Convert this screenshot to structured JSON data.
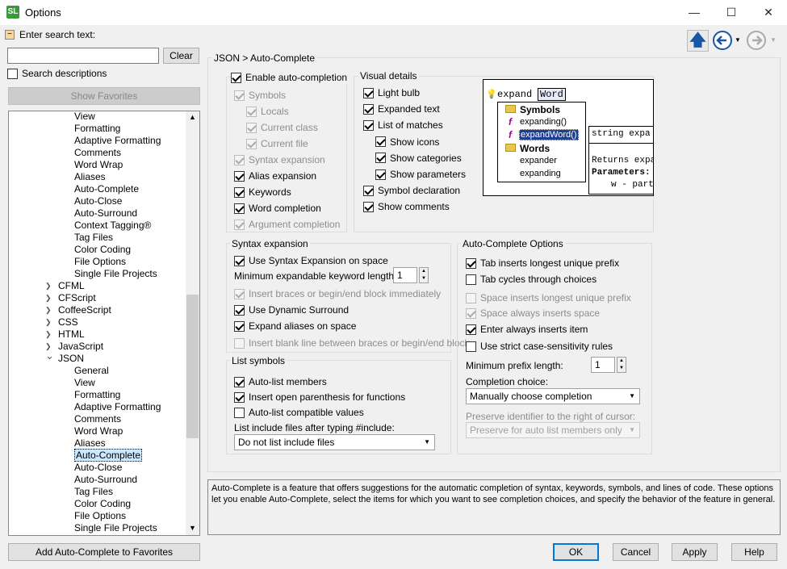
{
  "window": {
    "title": "Options",
    "app_icon_text": "SL",
    "minimize": "—",
    "maximize": "☐",
    "close": "✕"
  },
  "search": {
    "label": "Enter search text:",
    "value": "",
    "clear": "Clear",
    "desc_label": "Search descriptions",
    "show_favorites": "Show Favorites"
  },
  "nav": {
    "icons": [
      "up-arrow-icon",
      "back-arrow-icon",
      "forward-arrow-icon"
    ]
  },
  "tree": [
    {
      "label": "View",
      "level": 2
    },
    {
      "label": "Formatting",
      "level": 2
    },
    {
      "label": "Adaptive Formatting",
      "level": 2
    },
    {
      "label": "Comments",
      "level": 2
    },
    {
      "label": "Word Wrap",
      "level": 2
    },
    {
      "label": "Aliases",
      "level": 2
    },
    {
      "label": "Auto-Complete",
      "level": 2
    },
    {
      "label": "Auto-Close",
      "level": 2
    },
    {
      "label": "Auto-Surround",
      "level": 2
    },
    {
      "label": "Context Tagging®",
      "level": 2
    },
    {
      "label": "Tag Files",
      "level": 2
    },
    {
      "label": "Color Coding",
      "level": 2
    },
    {
      "label": "File Options",
      "level": 2
    },
    {
      "label": "Single File Projects",
      "level": 2
    },
    {
      "label": "CFML",
      "level": 1,
      "arrow": ">"
    },
    {
      "label": "CFScript",
      "level": 1,
      "arrow": ">"
    },
    {
      "label": "CoffeeScript",
      "level": 1,
      "arrow": ">"
    },
    {
      "label": "CSS",
      "level": 1,
      "arrow": ">"
    },
    {
      "label": "HTML",
      "level": 1,
      "arrow": ">"
    },
    {
      "label": "JavaScript",
      "level": 1,
      "arrow": ">"
    },
    {
      "label": "JSON",
      "level": 1,
      "arrow": "v"
    },
    {
      "label": "General",
      "level": 2
    },
    {
      "label": "View",
      "level": 2
    },
    {
      "label": "Formatting",
      "level": 2
    },
    {
      "label": "Adaptive Formatting",
      "level": 2
    },
    {
      "label": "Comments",
      "level": 2
    },
    {
      "label": "Word Wrap",
      "level": 2
    },
    {
      "label": "Aliases",
      "level": 2
    },
    {
      "label": "Auto-Complete",
      "level": 2,
      "selected": true
    },
    {
      "label": "Auto-Close",
      "level": 2
    },
    {
      "label": "Auto-Surround",
      "level": 2
    },
    {
      "label": "Tag Files",
      "level": 2
    },
    {
      "label": "Color Coding",
      "level": 2
    },
    {
      "label": "File Options",
      "level": 2
    },
    {
      "label": "Single File Projects",
      "level": 2
    }
  ],
  "add_favorites": "Add Auto-Complete to Favorites",
  "breadcrumb": "JSON > Auto-Complete",
  "enable": {
    "label": "Enable auto-completion",
    "checked": true
  },
  "enable_items": [
    {
      "label": "Symbols",
      "checked": true,
      "disabled": true,
      "indent": 0
    },
    {
      "label": "Locals",
      "checked": true,
      "disabled": true,
      "indent": 1
    },
    {
      "label": "Current class",
      "checked": true,
      "disabled": true,
      "indent": 1
    },
    {
      "label": "Current file",
      "checked": true,
      "disabled": true,
      "indent": 1
    },
    {
      "label": "Syntax expansion",
      "checked": true,
      "disabled": true,
      "indent": 0
    },
    {
      "label": "Alias expansion",
      "checked": true,
      "disabled": false,
      "indent": 0
    },
    {
      "label": "Keywords",
      "checked": true,
      "disabled": false,
      "indent": 0
    },
    {
      "label": "Word completion",
      "checked": true,
      "disabled": false,
      "indent": 0
    },
    {
      "label": "Argument completion",
      "checked": true,
      "disabled": true,
      "indent": 0
    }
  ],
  "visual": {
    "title": "Visual details",
    "items": [
      {
        "label": "Light bulb",
        "checked": true,
        "indent": 0
      },
      {
        "label": "Expanded text",
        "checked": true,
        "indent": 0
      },
      {
        "label": "List of matches",
        "checked": true,
        "indent": 0
      },
      {
        "label": "Show icons",
        "checked": true,
        "indent": 1
      },
      {
        "label": "Show categories",
        "checked": true,
        "indent": 1
      },
      {
        "label": "Show parameters",
        "checked": true,
        "indent": 1
      },
      {
        "label": "Symbol declaration",
        "checked": true,
        "indent": 0
      },
      {
        "label": "Show comments",
        "checked": true,
        "indent": 0
      }
    ]
  },
  "preview": {
    "typed": "expand",
    "word": "Word",
    "cat1": "Symbols",
    "s1": "expanding()",
    "s2": "expandWord()",
    "cat2": "Words",
    "w1": "expander",
    "w2": "expanding",
    "decl": "string expa",
    "returns": "Returns expa",
    "params": "Parameters:",
    "param1": "w - part"
  },
  "syntax": {
    "title": "Syntax expansion",
    "use_space": {
      "label": "Use Syntax Expansion on space",
      "checked": true
    },
    "min_len_label": "Minimum expandable keyword length:",
    "min_len": "1",
    "insert_braces": {
      "label": "Insert braces or begin/end block immediately",
      "checked": true
    },
    "dyn_surround": {
      "label": "Use Dynamic Surround",
      "checked": true
    },
    "expand_aliases": {
      "label": "Expand aliases on space",
      "checked": true
    },
    "blank_line": {
      "label": "Insert blank line between braces or begin/end block",
      "checked": false
    }
  },
  "list": {
    "title": "List symbols",
    "items": [
      {
        "label": "Auto-list members",
        "checked": true
      },
      {
        "label": "Insert open parenthesis for functions",
        "checked": true
      },
      {
        "label": "Auto-list compatible values",
        "checked": false
      }
    ],
    "include_label": "List include files after typing #include:",
    "include_value": "Do not list include files"
  },
  "acopts": {
    "title": "Auto-Complete Options",
    "items": [
      {
        "label": "Tab inserts longest unique prefix",
        "checked": true,
        "disabled": false
      },
      {
        "label": "Tab cycles through choices",
        "checked": false,
        "disabled": false
      },
      {
        "label": "Space inserts longest unique prefix",
        "checked": false,
        "disabled": true
      },
      {
        "label": "Space always inserts space",
        "checked": true,
        "disabled": true
      },
      {
        "label": "Enter always inserts item",
        "checked": true,
        "disabled": false
      },
      {
        "label": "Use strict case-sensitivity rules",
        "checked": false,
        "disabled": false
      }
    ],
    "min_prefix_label": "Minimum prefix length:",
    "min_prefix": "1",
    "choice_label": "Completion choice:",
    "choice_value": "Manually choose completion",
    "preserve_label": "Preserve identifier to the right of cursor:",
    "preserve_value": "Preserve for auto list members only"
  },
  "description": "Auto-Complete is a feature that offers suggestions for the automatic completion of syntax, keywords, symbols, and lines of code. These options let you enable Auto-Complete, select the items for which you want to see completion choices, and specify the behavior of the feature in general.",
  "buttons": {
    "ok": "OK",
    "cancel": "Cancel",
    "apply": "Apply",
    "help": "Help"
  }
}
